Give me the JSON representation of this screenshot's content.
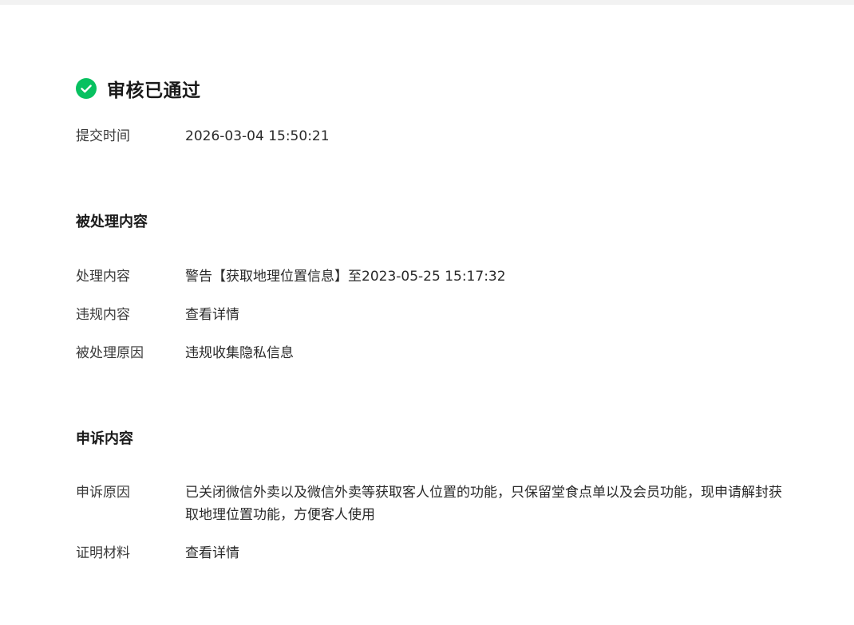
{
  "status": {
    "title": "审核已通过",
    "icon": "check-circle-icon",
    "color": "#07c160"
  },
  "submit": {
    "label": "提交时间",
    "value": "2026-03-04 15:50:21"
  },
  "processed": {
    "heading": "被处理内容",
    "items": [
      {
        "label": "处理内容",
        "value": "警告【获取地理位置信息】至2023-05-25 15:17:32"
      },
      {
        "label": "违规内容",
        "value": "查看详情"
      },
      {
        "label": "被处理原因",
        "value": "违规收集隐私信息"
      }
    ]
  },
  "appeal": {
    "heading": "申诉内容",
    "items": [
      {
        "label": "申诉原因",
        "value": "已关闭微信外卖以及微信外卖等获取客人位置的功能，只保留堂食点单以及会员功能，现申请解封获取地理位置功能，方便客人使用"
      },
      {
        "label": "证明材料",
        "value": "查看详情"
      }
    ]
  },
  "colors": {
    "link": "#576b95",
    "success": "#07c160"
  }
}
